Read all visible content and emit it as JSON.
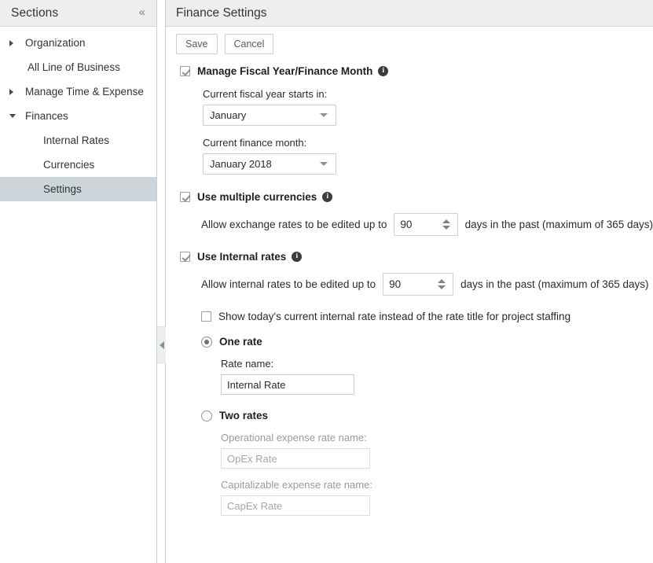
{
  "sidebar": {
    "title": "Sections",
    "collapse_icon": "«",
    "items": [
      {
        "label": "Organization",
        "level": 1,
        "arrow": "right",
        "selected": false
      },
      {
        "label": "All Line of Business",
        "level": 1,
        "arrow": "none",
        "selected": false
      },
      {
        "label": "Manage Time & Expense",
        "level": 1,
        "arrow": "right",
        "selected": false
      },
      {
        "label": "Finances",
        "level": 1,
        "arrow": "down",
        "selected": false
      },
      {
        "label": "Internal Rates",
        "level": 2,
        "arrow": "none",
        "selected": false
      },
      {
        "label": "Currencies",
        "level": 2,
        "arrow": "none",
        "selected": false
      },
      {
        "label": "Settings",
        "level": 2,
        "arrow": "none",
        "selected": true
      }
    ]
  },
  "splitter": {
    "arrow": "◀"
  },
  "main": {
    "title": "Finance Settings",
    "toolbar": {
      "save_label": "Save",
      "cancel_label": "Cancel"
    },
    "fiscal": {
      "checkbox_label": "Manage Fiscal Year/Finance Month",
      "checked": true,
      "info_char": "i",
      "fiscal_year_label": "Current fiscal year starts in:",
      "fiscal_year_value": "January",
      "finance_month_label": "Current finance month:",
      "finance_month_value": "January 2018"
    },
    "currencies": {
      "checkbox_label": "Use multiple currencies",
      "checked": true,
      "info_char": "i",
      "exchange_pre": "Allow exchange rates to be edited up to",
      "exchange_value": "90",
      "exchange_post": "days in the past (maximum of 365 days)"
    },
    "internal_rates": {
      "checkbox_label": "Use Internal rates",
      "checked": true,
      "info_char": "i",
      "internal_pre": "Allow internal rates to be edited up to",
      "internal_value": "90",
      "internal_post": "days in the past (maximum of 365 days)",
      "show_today_label": "Show today's current internal rate instead of the rate title for project staffing",
      "show_today_checked": false,
      "one_rate_label": "One rate",
      "one_rate_selected": true,
      "rate_name_label": "Rate name:",
      "rate_name_value": "Internal Rate",
      "two_rates_label": "Two rates",
      "two_rates_selected": false,
      "opex_label": "Operational expense rate name:",
      "opex_value": "OpEx Rate",
      "capex_label": "Capitalizable expense rate name:",
      "capex_value": "CapEx Rate"
    }
  }
}
